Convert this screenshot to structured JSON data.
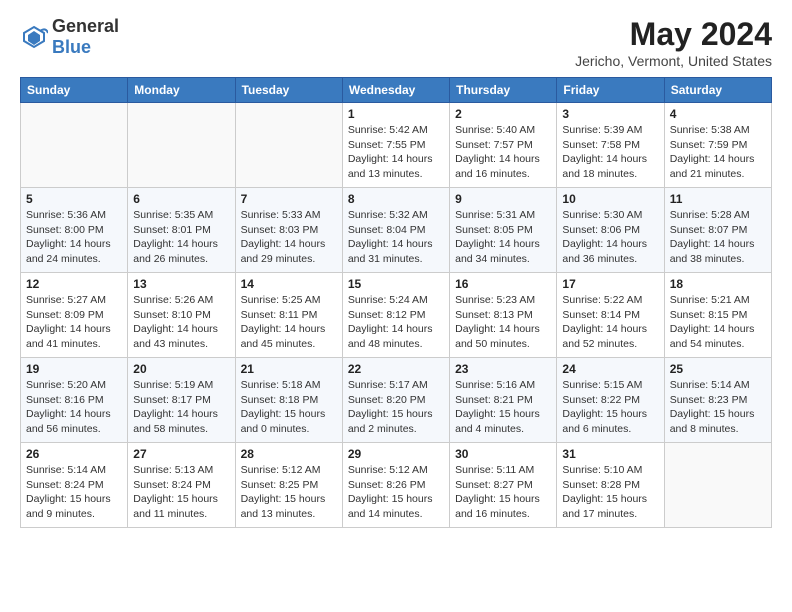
{
  "header": {
    "logo": {
      "line1": "General",
      "line2": "Blue"
    },
    "title": "May 2024",
    "location": "Jericho, Vermont, United States"
  },
  "weekdays": [
    "Sunday",
    "Monday",
    "Tuesday",
    "Wednesday",
    "Thursday",
    "Friday",
    "Saturday"
  ],
  "weeks": [
    [
      {
        "day": "",
        "info": ""
      },
      {
        "day": "",
        "info": ""
      },
      {
        "day": "",
        "info": ""
      },
      {
        "day": "1",
        "info": "Sunrise: 5:42 AM\nSunset: 7:55 PM\nDaylight: 14 hours\nand 13 minutes."
      },
      {
        "day": "2",
        "info": "Sunrise: 5:40 AM\nSunset: 7:57 PM\nDaylight: 14 hours\nand 16 minutes."
      },
      {
        "day": "3",
        "info": "Sunrise: 5:39 AM\nSunset: 7:58 PM\nDaylight: 14 hours\nand 18 minutes."
      },
      {
        "day": "4",
        "info": "Sunrise: 5:38 AM\nSunset: 7:59 PM\nDaylight: 14 hours\nand 21 minutes."
      }
    ],
    [
      {
        "day": "5",
        "info": "Sunrise: 5:36 AM\nSunset: 8:00 PM\nDaylight: 14 hours\nand 24 minutes."
      },
      {
        "day": "6",
        "info": "Sunrise: 5:35 AM\nSunset: 8:01 PM\nDaylight: 14 hours\nand 26 minutes."
      },
      {
        "day": "7",
        "info": "Sunrise: 5:33 AM\nSunset: 8:03 PM\nDaylight: 14 hours\nand 29 minutes."
      },
      {
        "day": "8",
        "info": "Sunrise: 5:32 AM\nSunset: 8:04 PM\nDaylight: 14 hours\nand 31 minutes."
      },
      {
        "day": "9",
        "info": "Sunrise: 5:31 AM\nSunset: 8:05 PM\nDaylight: 14 hours\nand 34 minutes."
      },
      {
        "day": "10",
        "info": "Sunrise: 5:30 AM\nSunset: 8:06 PM\nDaylight: 14 hours\nand 36 minutes."
      },
      {
        "day": "11",
        "info": "Sunrise: 5:28 AM\nSunset: 8:07 PM\nDaylight: 14 hours\nand 38 minutes."
      }
    ],
    [
      {
        "day": "12",
        "info": "Sunrise: 5:27 AM\nSunset: 8:09 PM\nDaylight: 14 hours\nand 41 minutes."
      },
      {
        "day": "13",
        "info": "Sunrise: 5:26 AM\nSunset: 8:10 PM\nDaylight: 14 hours\nand 43 minutes."
      },
      {
        "day": "14",
        "info": "Sunrise: 5:25 AM\nSunset: 8:11 PM\nDaylight: 14 hours\nand 45 minutes."
      },
      {
        "day": "15",
        "info": "Sunrise: 5:24 AM\nSunset: 8:12 PM\nDaylight: 14 hours\nand 48 minutes."
      },
      {
        "day": "16",
        "info": "Sunrise: 5:23 AM\nSunset: 8:13 PM\nDaylight: 14 hours\nand 50 minutes."
      },
      {
        "day": "17",
        "info": "Sunrise: 5:22 AM\nSunset: 8:14 PM\nDaylight: 14 hours\nand 52 minutes."
      },
      {
        "day": "18",
        "info": "Sunrise: 5:21 AM\nSunset: 8:15 PM\nDaylight: 14 hours\nand 54 minutes."
      }
    ],
    [
      {
        "day": "19",
        "info": "Sunrise: 5:20 AM\nSunset: 8:16 PM\nDaylight: 14 hours\nand 56 minutes."
      },
      {
        "day": "20",
        "info": "Sunrise: 5:19 AM\nSunset: 8:17 PM\nDaylight: 14 hours\nand 58 minutes."
      },
      {
        "day": "21",
        "info": "Sunrise: 5:18 AM\nSunset: 8:18 PM\nDaylight: 15 hours\nand 0 minutes."
      },
      {
        "day": "22",
        "info": "Sunrise: 5:17 AM\nSunset: 8:20 PM\nDaylight: 15 hours\nand 2 minutes."
      },
      {
        "day": "23",
        "info": "Sunrise: 5:16 AM\nSunset: 8:21 PM\nDaylight: 15 hours\nand 4 minutes."
      },
      {
        "day": "24",
        "info": "Sunrise: 5:15 AM\nSunset: 8:22 PM\nDaylight: 15 hours\nand 6 minutes."
      },
      {
        "day": "25",
        "info": "Sunrise: 5:14 AM\nSunset: 8:23 PM\nDaylight: 15 hours\nand 8 minutes."
      }
    ],
    [
      {
        "day": "26",
        "info": "Sunrise: 5:14 AM\nSunset: 8:24 PM\nDaylight: 15 hours\nand 9 minutes."
      },
      {
        "day": "27",
        "info": "Sunrise: 5:13 AM\nSunset: 8:24 PM\nDaylight: 15 hours\nand 11 minutes."
      },
      {
        "day": "28",
        "info": "Sunrise: 5:12 AM\nSunset: 8:25 PM\nDaylight: 15 hours\nand 13 minutes."
      },
      {
        "day": "29",
        "info": "Sunrise: 5:12 AM\nSunset: 8:26 PM\nDaylight: 15 hours\nand 14 minutes."
      },
      {
        "day": "30",
        "info": "Sunrise: 5:11 AM\nSunset: 8:27 PM\nDaylight: 15 hours\nand 16 minutes."
      },
      {
        "day": "31",
        "info": "Sunrise: 5:10 AM\nSunset: 8:28 PM\nDaylight: 15 hours\nand 17 minutes."
      },
      {
        "day": "",
        "info": ""
      }
    ]
  ]
}
